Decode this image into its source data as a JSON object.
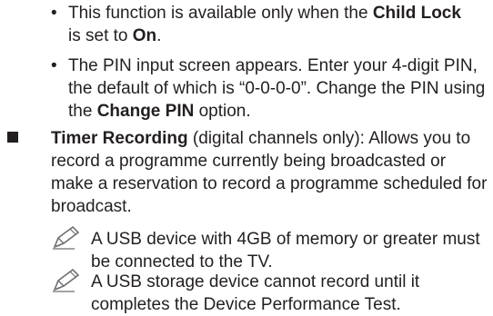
{
  "bullets": [
    {
      "t1": "This function is available only when the ",
      "b1": "Child Lock",
      "t2": " is set to ",
      "b2": "On",
      "t3": "."
    },
    {
      "t1": "The PIN input screen appears. Enter your 4-digit PIN, the default of which is “0-0-0-0”. Change the PIN using the ",
      "b1": "Change PIN",
      "t2": " option."
    }
  ],
  "timer": {
    "title": "Timer Recording",
    "text": " (digital channels only): Allows you to record a programme currently being broadcasted or make a reservation to record a programme scheduled for broadcast."
  },
  "notes": [
    {
      "text": "A USB device with 4GB of memory or greater must be connected to the TV."
    },
    {
      "text": "A USB storage device cannot record until it completes the Device Performance Test."
    }
  ],
  "colors": {
    "text": "#231f20"
  }
}
